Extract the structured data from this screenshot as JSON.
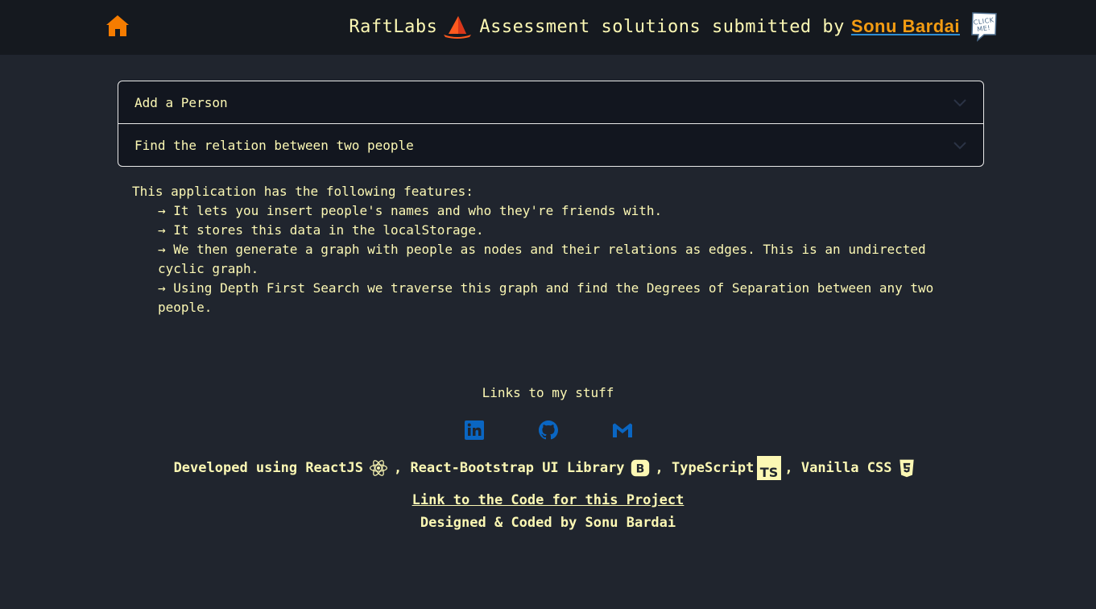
{
  "header": {
    "brand": "RaftLabs",
    "title_text": "Assessment solutions submitted by",
    "author": "Sonu Bardai",
    "click_me": "CLICK ME!"
  },
  "accordion": {
    "items": [
      {
        "label": "Add a Person"
      },
      {
        "label": "Find the relation between two people"
      }
    ]
  },
  "features": {
    "intro": "This application has the following features:",
    "items": [
      "→ It lets you insert people's names and who they're friends with.",
      "→ It stores this data in the localStorage.",
      "→ We then generate a graph with people as nodes and their relations as edges. This is an undirected cyclic graph.",
      "→ Using Depth First Search we traverse this graph and find the Degrees of Separation between any two people."
    ]
  },
  "footer": {
    "links_title": "Links to my stuff",
    "socials": [
      "linkedin-icon",
      "github-icon",
      "gmail-icon"
    ],
    "tech_prefix": "Developed using ReactJS",
    "tech_bootstrap": ", React-Bootstrap UI Library",
    "tech_ts": ", TypeScript",
    "tech_css": ", Vanilla CSS",
    "ts_badge": "TS",
    "bootstrap_badge": "B",
    "code_link": "Link to the Code for this Project",
    "designed_by": "Designed & Coded by Sonu Bardai"
  },
  "colors": {
    "background": "#20252e",
    "topbar": "#15191f",
    "text": "#fcf8b4",
    "accent_orange": "#f39c12",
    "social_blue": "#0a66c2"
  }
}
